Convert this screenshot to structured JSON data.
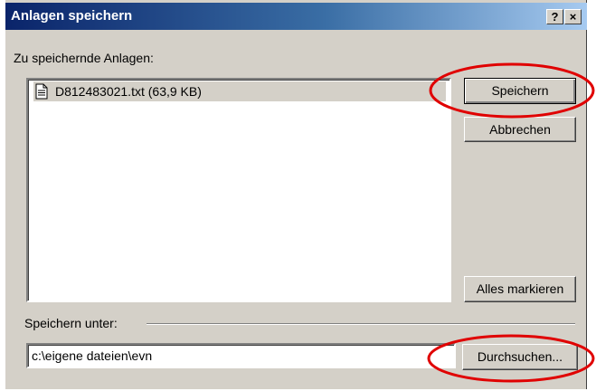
{
  "window": {
    "title": "Anlagen speichern",
    "help_button": "?",
    "close_button": "×"
  },
  "attachments": {
    "label": "Zu speichernde Anlagen:",
    "items": [
      {
        "name": "D812483021.txt (63,9 KB)",
        "icon": "text-file-icon",
        "selected": true
      }
    ]
  },
  "buttons": {
    "save": "Speichern",
    "cancel": "Abbrechen",
    "select_all": "Alles markieren",
    "browse": "Durchsuchen..."
  },
  "save_to": {
    "label": "Speichern unter:",
    "value": "c:\\eigene dateien\\evn"
  },
  "colors": {
    "dialog_bg": "#d4d0c8",
    "title_start": "#0a246a",
    "title_end": "#a6caf0",
    "annotation": "#e00000"
  }
}
